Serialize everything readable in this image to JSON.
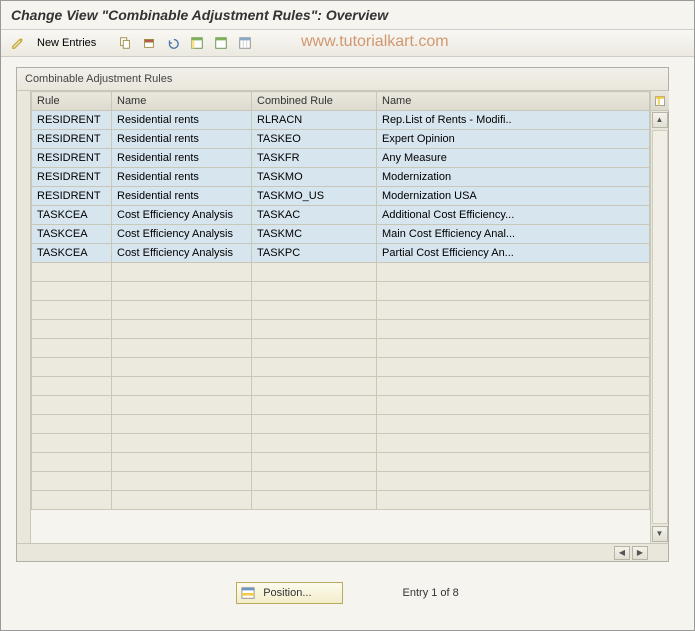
{
  "title": "Change View \"Combinable Adjustment Rules\": Overview",
  "toolbar": {
    "new_entries": "New Entries"
  },
  "watermark": "www.tutorialkart.com",
  "panel": {
    "title": "Combinable Adjustment Rules",
    "headers": {
      "c1": "Rule",
      "c2": "Name",
      "c3": "Combined Rule",
      "c4": "Name"
    },
    "rows": [
      {
        "rule": "RESIDRENT",
        "name1": "Residential rents",
        "crule": "RLRACN",
        "name2": "Rep.List of Rents - Modifi.."
      },
      {
        "rule": "RESIDRENT",
        "name1": "Residential rents",
        "crule": "TASKEO",
        "name2": "Expert Opinion"
      },
      {
        "rule": "RESIDRENT",
        "name1": "Residential rents",
        "crule": "TASKFR",
        "name2": "Any Measure"
      },
      {
        "rule": "RESIDRENT",
        "name1": "Residential rents",
        "crule": "TASKMO",
        "name2": "Modernization"
      },
      {
        "rule": "RESIDRENT",
        "name1": "Residential rents",
        "crule": "TASKMO_US",
        "name2": "Modernization USA"
      },
      {
        "rule": "TASKCEA",
        "name1": "Cost Efficiency Analysis",
        "crule": "TASKAC",
        "name2": "Additional Cost Efficiency..."
      },
      {
        "rule": "TASKCEA",
        "name1": "Cost Efficiency Analysis",
        "crule": "TASKMC",
        "name2": "Main Cost Efficiency Anal..."
      },
      {
        "rule": "TASKCEA",
        "name1": "Cost Efficiency Analysis",
        "crule": "TASKPC",
        "name2": "Partial Cost Efficiency An..."
      }
    ]
  },
  "footer": {
    "position": "Position...",
    "entry_text": "Entry 1 of 8"
  }
}
